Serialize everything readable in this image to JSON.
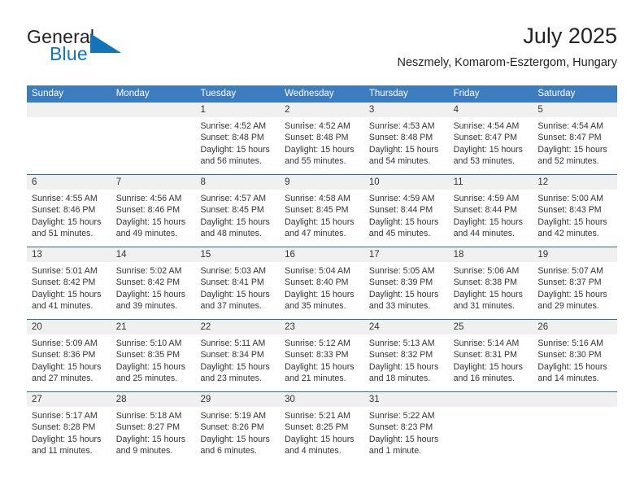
{
  "brand": {
    "name_dark": "General",
    "name_light": "Blue",
    "mark": "triangle-flag-icon",
    "accent_color": "#1274bc"
  },
  "header": {
    "title": "July 2025",
    "subtitle": "Neszmely, Komarom-Esztergom, Hungary"
  },
  "theme": {
    "header_blue": "#3b7dc0",
    "separator_blue": "#2a6cb0",
    "daynum_band": "#f0f0f0",
    "text": "#333333"
  },
  "weekdays": [
    "Sunday",
    "Monday",
    "Tuesday",
    "Wednesday",
    "Thursday",
    "Friday",
    "Saturday"
  ],
  "weeks": [
    {
      "days": [
        {
          "num": "",
          "lines": []
        },
        {
          "num": "",
          "lines": []
        },
        {
          "num": "1",
          "lines": [
            "Sunrise: 4:52 AM",
            "Sunset: 8:48 PM",
            "Daylight: 15 hours",
            "and 56 minutes."
          ]
        },
        {
          "num": "2",
          "lines": [
            "Sunrise: 4:52 AM",
            "Sunset: 8:48 PM",
            "Daylight: 15 hours",
            "and 55 minutes."
          ]
        },
        {
          "num": "3",
          "lines": [
            "Sunrise: 4:53 AM",
            "Sunset: 8:48 PM",
            "Daylight: 15 hours",
            "and 54 minutes."
          ]
        },
        {
          "num": "4",
          "lines": [
            "Sunrise: 4:54 AM",
            "Sunset: 8:47 PM",
            "Daylight: 15 hours",
            "and 53 minutes."
          ]
        },
        {
          "num": "5",
          "lines": [
            "Sunrise: 4:54 AM",
            "Sunset: 8:47 PM",
            "Daylight: 15 hours",
            "and 52 minutes."
          ]
        }
      ]
    },
    {
      "days": [
        {
          "num": "6",
          "lines": [
            "Sunrise: 4:55 AM",
            "Sunset: 8:46 PM",
            "Daylight: 15 hours",
            "and 51 minutes."
          ]
        },
        {
          "num": "7",
          "lines": [
            "Sunrise: 4:56 AM",
            "Sunset: 8:46 PM",
            "Daylight: 15 hours",
            "and 49 minutes."
          ]
        },
        {
          "num": "8",
          "lines": [
            "Sunrise: 4:57 AM",
            "Sunset: 8:45 PM",
            "Daylight: 15 hours",
            "and 48 minutes."
          ]
        },
        {
          "num": "9",
          "lines": [
            "Sunrise: 4:58 AM",
            "Sunset: 8:45 PM",
            "Daylight: 15 hours",
            "and 47 minutes."
          ]
        },
        {
          "num": "10",
          "lines": [
            "Sunrise: 4:59 AM",
            "Sunset: 8:44 PM",
            "Daylight: 15 hours",
            "and 45 minutes."
          ]
        },
        {
          "num": "11",
          "lines": [
            "Sunrise: 4:59 AM",
            "Sunset: 8:44 PM",
            "Daylight: 15 hours",
            "and 44 minutes."
          ]
        },
        {
          "num": "12",
          "lines": [
            "Sunrise: 5:00 AM",
            "Sunset: 8:43 PM",
            "Daylight: 15 hours",
            "and 42 minutes."
          ]
        }
      ]
    },
    {
      "days": [
        {
          "num": "13",
          "lines": [
            "Sunrise: 5:01 AM",
            "Sunset: 8:42 PM",
            "Daylight: 15 hours",
            "and 41 minutes."
          ]
        },
        {
          "num": "14",
          "lines": [
            "Sunrise: 5:02 AM",
            "Sunset: 8:42 PM",
            "Daylight: 15 hours",
            "and 39 minutes."
          ]
        },
        {
          "num": "15",
          "lines": [
            "Sunrise: 5:03 AM",
            "Sunset: 8:41 PM",
            "Daylight: 15 hours",
            "and 37 minutes."
          ]
        },
        {
          "num": "16",
          "lines": [
            "Sunrise: 5:04 AM",
            "Sunset: 8:40 PM",
            "Daylight: 15 hours",
            "and 35 minutes."
          ]
        },
        {
          "num": "17",
          "lines": [
            "Sunrise: 5:05 AM",
            "Sunset: 8:39 PM",
            "Daylight: 15 hours",
            "and 33 minutes."
          ]
        },
        {
          "num": "18",
          "lines": [
            "Sunrise: 5:06 AM",
            "Sunset: 8:38 PM",
            "Daylight: 15 hours",
            "and 31 minutes."
          ]
        },
        {
          "num": "19",
          "lines": [
            "Sunrise: 5:07 AM",
            "Sunset: 8:37 PM",
            "Daylight: 15 hours",
            "and 29 minutes."
          ]
        }
      ]
    },
    {
      "days": [
        {
          "num": "20",
          "lines": [
            "Sunrise: 5:09 AM",
            "Sunset: 8:36 PM",
            "Daylight: 15 hours",
            "and 27 minutes."
          ]
        },
        {
          "num": "21",
          "lines": [
            "Sunrise: 5:10 AM",
            "Sunset: 8:35 PM",
            "Daylight: 15 hours",
            "and 25 minutes."
          ]
        },
        {
          "num": "22",
          "lines": [
            "Sunrise: 5:11 AM",
            "Sunset: 8:34 PM",
            "Daylight: 15 hours",
            "and 23 minutes."
          ]
        },
        {
          "num": "23",
          "lines": [
            "Sunrise: 5:12 AM",
            "Sunset: 8:33 PM",
            "Daylight: 15 hours",
            "and 21 minutes."
          ]
        },
        {
          "num": "24",
          "lines": [
            "Sunrise: 5:13 AM",
            "Sunset: 8:32 PM",
            "Daylight: 15 hours",
            "and 18 minutes."
          ]
        },
        {
          "num": "25",
          "lines": [
            "Sunrise: 5:14 AM",
            "Sunset: 8:31 PM",
            "Daylight: 15 hours",
            "and 16 minutes."
          ]
        },
        {
          "num": "26",
          "lines": [
            "Sunrise: 5:16 AM",
            "Sunset: 8:30 PM",
            "Daylight: 15 hours",
            "and 14 minutes."
          ]
        }
      ]
    },
    {
      "days": [
        {
          "num": "27",
          "lines": [
            "Sunrise: 5:17 AM",
            "Sunset: 8:28 PM",
            "Daylight: 15 hours",
            "and 11 minutes."
          ]
        },
        {
          "num": "28",
          "lines": [
            "Sunrise: 5:18 AM",
            "Sunset: 8:27 PM",
            "Daylight: 15 hours",
            "and 9 minutes."
          ]
        },
        {
          "num": "29",
          "lines": [
            "Sunrise: 5:19 AM",
            "Sunset: 8:26 PM",
            "Daylight: 15 hours",
            "and 6 minutes."
          ]
        },
        {
          "num": "30",
          "lines": [
            "Sunrise: 5:21 AM",
            "Sunset: 8:25 PM",
            "Daylight: 15 hours",
            "and 4 minutes."
          ]
        },
        {
          "num": "31",
          "lines": [
            "Sunrise: 5:22 AM",
            "Sunset: 8:23 PM",
            "Daylight: 15 hours",
            "and 1 minute."
          ]
        },
        {
          "num": "",
          "lines": []
        },
        {
          "num": "",
          "lines": []
        }
      ]
    }
  ]
}
